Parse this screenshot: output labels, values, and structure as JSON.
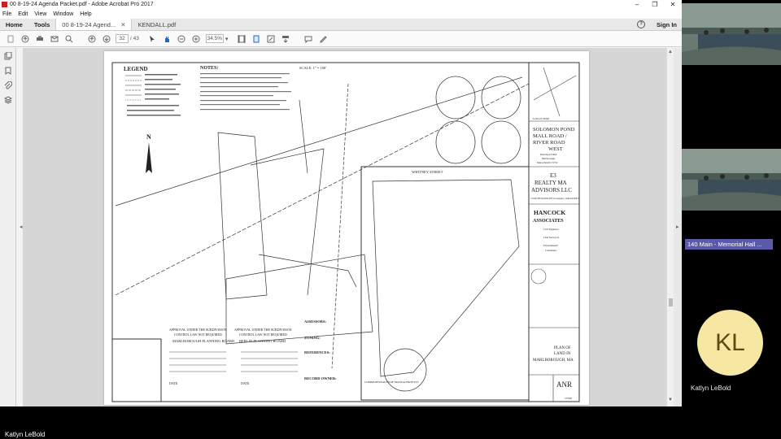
{
  "window": {
    "title": "00 8-19-24 Agenda Packet.pdf - Adobe Acrobat Pro 2017",
    "controls": [
      "–",
      "❐",
      "✕"
    ]
  },
  "menu": [
    "File",
    "Edit",
    "View",
    "Window",
    "Help"
  ],
  "tabs": {
    "home": "Home",
    "tools": "Tools",
    "doc1": "00 8-19-24 Agend...",
    "doc1_close": "✕",
    "doc2": "KENDALL.pdf",
    "help": "?",
    "signin": "Sign In"
  },
  "toolbar": {
    "page_current": "32",
    "page_total": "/ 43",
    "zoom": "34.5%"
  },
  "drawing": {
    "legend": "LEGEND",
    "notes": "NOTES:",
    "scale": "SCALE: 1\" = 100'",
    "locus": "LOCUS MAP",
    "project": [
      "SOLOMON POND",
      "MALL ROAD /",
      "RIVER ROAD",
      "WEST"
    ],
    "project_sub": [
      "River Road West",
      "Marlborough,",
      "Massachusetts 01752"
    ],
    "prepared_for": [
      "E3",
      "REALTY MA",
      "ADVISORS LLC"
    ],
    "prepared_sub": "13 SOUTH GRAND AVE Los Angeles, California 90071",
    "firm": [
      "HANCOCK",
      "ASSOCIATES"
    ],
    "firm_sub": [
      "Civil Engineers",
      "Land Surveyors",
      "Environmental",
      "Consultants"
    ],
    "plan_title": [
      "PLAN OF",
      "LAND IN",
      "MARLBOROUGH, MA"
    ],
    "anr": "ANR",
    "sheet_no": "27589",
    "approval1": [
      "APPROVAL UNDER THE SUBDIVISION",
      "CONTROL LAW NOT REQUIRED",
      "MARLBOROUGH PLANNING BOARD"
    ],
    "approval2": [
      "APPROVAL UNDER THE SUBDIVISION",
      "CONTROL LAW NOT REQUIRED",
      "BERLIN PLANNING BOARD"
    ],
    "date_label": "DATE:",
    "assessors": "ASSESSORS:",
    "zoning": "ZONING:",
    "references": "REFERENCES:",
    "record_owner": "RECORD OWNER:",
    "street_label": "WHITNEY STREET",
    "commonwealth": "COMMONWEALTH OF MASSACHUSETTS",
    "north": "N"
  },
  "participants": {
    "room": "140 Main - Memorial Hall ...",
    "initials": "KL",
    "name": "Katlyn LeBold",
    "active_speaker": "Katlyn LeBold"
  }
}
